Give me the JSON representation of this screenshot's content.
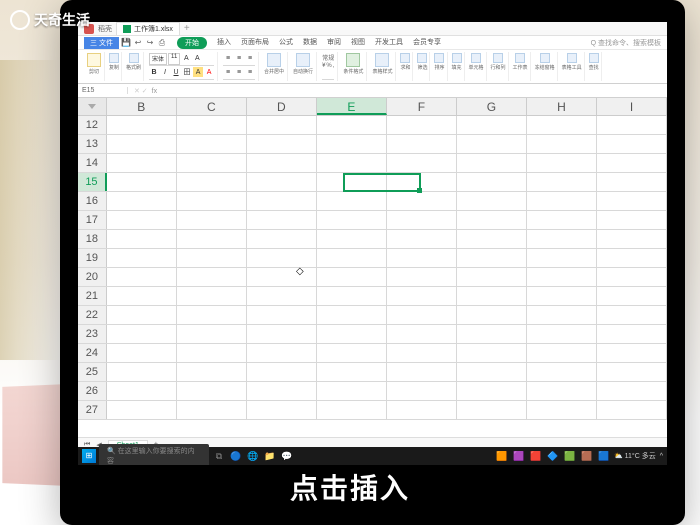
{
  "watermark": "天奇生活",
  "app": {
    "tab_title": "工作簿1.xlsx",
    "file_menu": "三 文件",
    "quick_icons": [
      "↩",
      "↪",
      "⎙",
      "✂",
      "⧉"
    ],
    "menu_tabs": [
      "开始",
      "插入",
      "页面布局",
      "公式",
      "数据",
      "审阅",
      "视图",
      "开发工具",
      "会员专享"
    ],
    "active_menu": "开始",
    "search_placeholder": "Q 查找命令、搜索模板"
  },
  "ribbon": {
    "groups": [
      {
        "icon": "cut",
        "label": "剪切"
      },
      {
        "icon": "copy",
        "label": "复制"
      },
      {
        "icon": "fmt",
        "label": "格式刷"
      }
    ],
    "font_name": "宋体",
    "font_size": "11",
    "align_labels": [
      "合并居中",
      "自动换行"
    ],
    "mid_labels": [
      "常规",
      "",
      "条件格式",
      "表格样式"
    ],
    "right_labels": [
      "求和",
      "筛选",
      "排序",
      "填充",
      "单元格",
      "行和列",
      "工作表",
      "冻结窗格",
      "表格工具",
      "查找"
    ]
  },
  "namebox": {
    "cell": "E15",
    "fx": "fx"
  },
  "columns": [
    "B",
    "C",
    "D",
    "E",
    "F",
    "G",
    "H",
    "I"
  ],
  "rows": [
    12,
    13,
    14,
    15,
    16,
    17,
    18,
    19,
    20,
    21,
    22,
    23,
    24,
    25,
    26,
    27
  ],
  "active_cell": {
    "col": "E",
    "row": 15
  },
  "sheet_tab": "Sheet1",
  "taskbar": {
    "search": "在这里输入你要搜索的内容",
    "weather": "⛅ 11°C 多云",
    "apps": [
      "🔵",
      "🌐",
      "📁",
      "💬",
      "🟧",
      "🟪",
      "🟥",
      "🔷",
      "🟩",
      "🟫",
      "🟦"
    ]
  },
  "caption": "点击插入"
}
